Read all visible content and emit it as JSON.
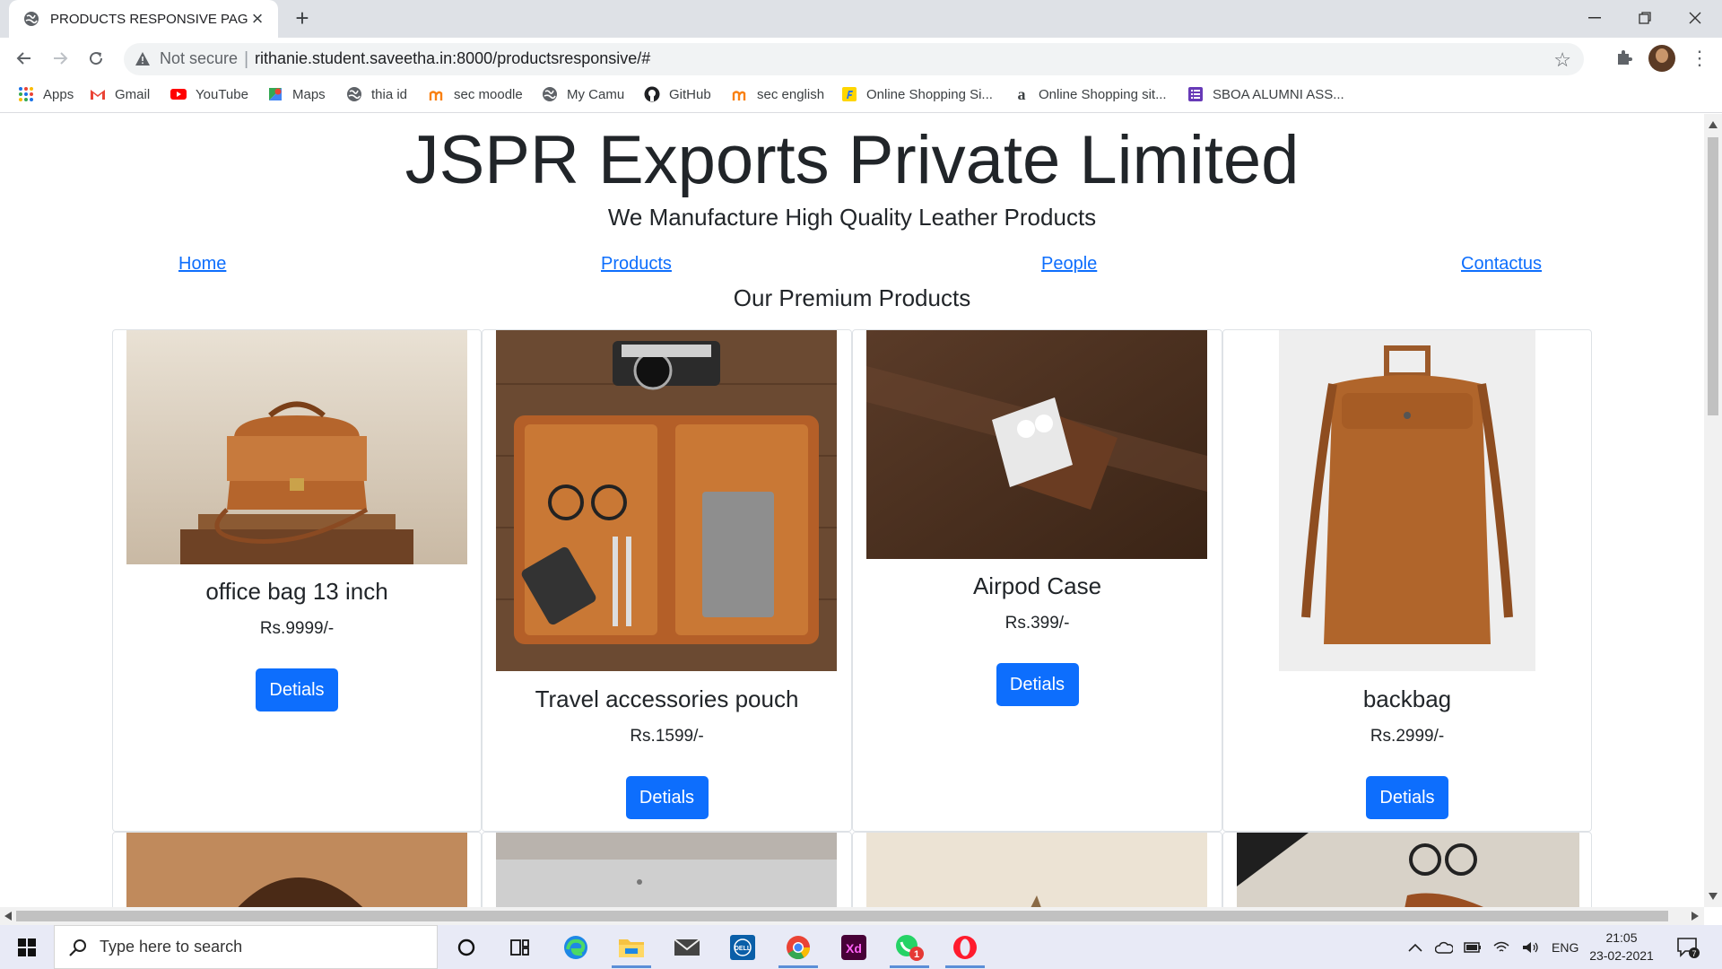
{
  "browser": {
    "tab_title": "PRODUCTS RESPONSIVE PAGE",
    "security_label": "Not secure",
    "url": "rithanie.student.saveetha.in:8000/productsresponsive/#",
    "bookmarks": [
      {
        "label": "Apps",
        "icon": "apps-grid-icon"
      },
      {
        "label": "Gmail",
        "icon": "gmail-icon"
      },
      {
        "label": "YouTube",
        "icon": "youtube-icon"
      },
      {
        "label": "Maps",
        "icon": "maps-icon"
      },
      {
        "label": "thia id",
        "icon": "globe-icon"
      },
      {
        "label": "sec moodle",
        "icon": "moodle-icon"
      },
      {
        "label": "My Camu",
        "icon": "globe-icon"
      },
      {
        "label": "GitHub",
        "icon": "github-icon"
      },
      {
        "label": "sec english",
        "icon": "moodle-icon"
      },
      {
        "label": "Online Shopping Si...",
        "icon": "flipkart-icon"
      },
      {
        "label": "Online Shopping sit...",
        "icon": "amazon-icon"
      },
      {
        "label": "SBOA ALUMNI ASS...",
        "icon": "form-icon"
      }
    ]
  },
  "page": {
    "title": "JSPR Exports Private Limited",
    "subtitle": "We Manufacture High Quality Leather Products",
    "nav": [
      "Home",
      "Products",
      "People",
      "Contactus"
    ],
    "section_heading": "Our Premium Products",
    "button_label": "Detials",
    "products": [
      {
        "name": "office bag 13 inch",
        "price": "Rs.9999/-"
      },
      {
        "name": "Travel accessories pouch",
        "price": "Rs.1599/-"
      },
      {
        "name": "Airpod Case",
        "price": "Rs.399/-"
      },
      {
        "name": "backbag",
        "price": "Rs.2999/-"
      }
    ]
  },
  "taskbar": {
    "search_placeholder": "Type here to search",
    "language": "ENG",
    "time": "21:05",
    "date": "23-02-2021",
    "notification_count": "7",
    "whatsapp_badge": "1"
  },
  "colors": {
    "primary_button": "#0d6efd",
    "link": "#0d6efd"
  }
}
